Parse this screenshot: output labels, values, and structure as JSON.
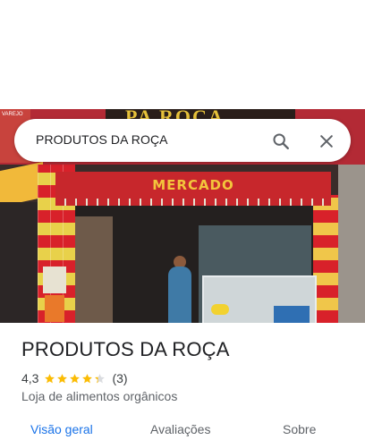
{
  "search": {
    "query": "PRODUTOS DA ROÇA"
  },
  "photo": {
    "shop_sign_text": "PA ROÇA",
    "awning_text": "MERCADO",
    "left_sign_text": "VAREJO"
  },
  "place": {
    "title": "PRODUTOS DA ROÇA",
    "rating": "4,3",
    "rating_value": 4.3,
    "star_count": 5,
    "review_count": "(3)",
    "category": "Loja de alimentos orgânicos"
  },
  "tabs": [
    {
      "label": "Visão geral",
      "active": true
    },
    {
      "label": "Avaliações",
      "active": false
    },
    {
      "label": "Sobre",
      "active": false
    }
  ],
  "colors": {
    "accent": "#1a73e8",
    "star": "#fbbc04",
    "star_empty": "#dadce0"
  },
  "icons": {
    "search": "search-icon",
    "close": "close-icon"
  }
}
